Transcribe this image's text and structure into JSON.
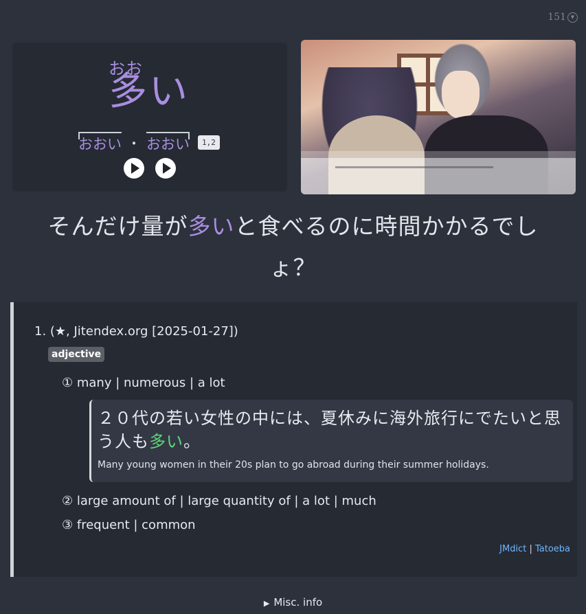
{
  "counter": {
    "value": "151"
  },
  "word": {
    "furigana": "おお",
    "expression": "多い",
    "pitch_a": "おおい",
    "pitch_separator": "・",
    "pitch_b": "おおい",
    "pitch_badge": "1,2"
  },
  "audio": {
    "buttons": [
      "play",
      "play"
    ]
  },
  "screenshot": {
    "description_icon": "game-screenshot-image"
  },
  "sentence": {
    "before": "そんだけ量が",
    "highlight": "多い",
    "after": "と食べるのに時間かかるでしょ？"
  },
  "definitions": {
    "header": "1. (★, Jitendex.org [2025-01-27])",
    "pos": "adjective",
    "glosses": [
      "① many | numerous | a lot",
      "② large amount of | large quantity of | a lot | much",
      "③ frequent | common"
    ],
    "example": {
      "jp_before": "２０代の若い女性の中には、夏休みに海外旅行にでたいと思う人も",
      "jp_highlight": "多い",
      "jp_after": "。",
      "en": "Many young women in their 20s plan to go abroad during their summer holidays."
    },
    "sources": {
      "jmdict": "JMdict",
      "separator": " | ",
      "tatoeba": "Tatoeba"
    }
  },
  "misc": {
    "label": "Misc. info"
  },
  "colors": {
    "accent": "#a98ee0",
    "example_highlight": "#5fd77a",
    "link": "#70b6ff"
  }
}
